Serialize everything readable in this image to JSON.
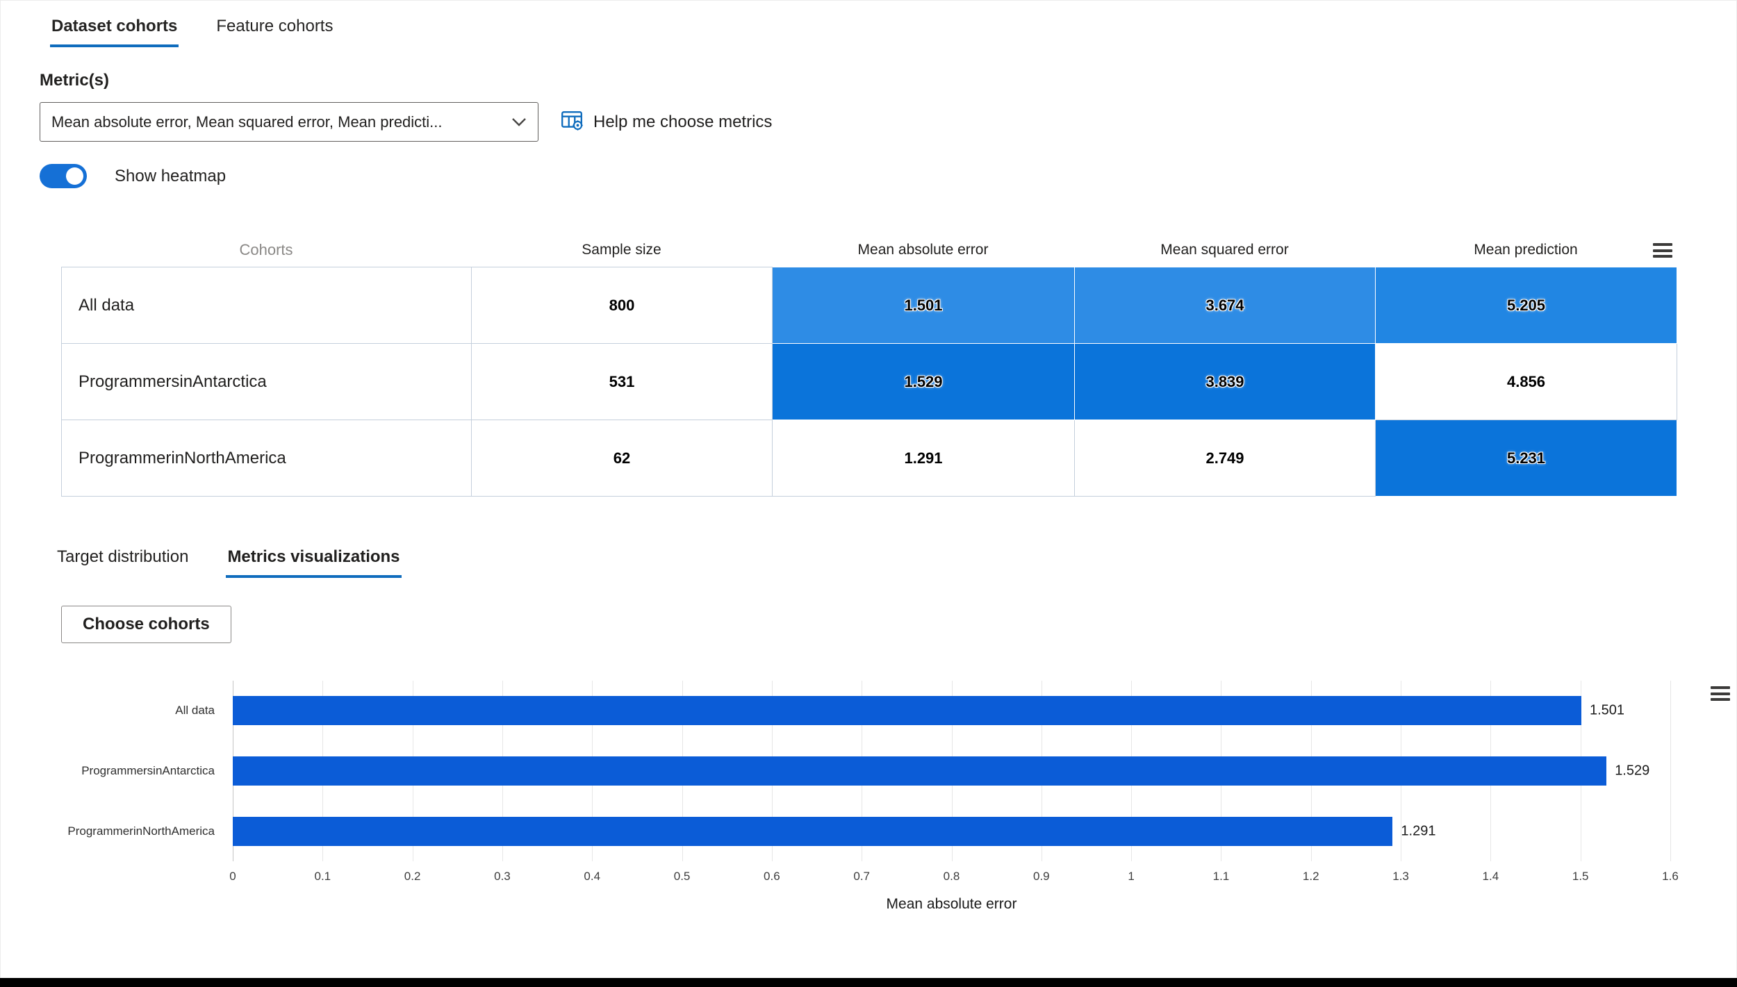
{
  "page": {
    "tabs": [
      {
        "label": "Dataset cohorts",
        "active": true
      },
      {
        "label": "Feature cohorts",
        "active": false
      }
    ]
  },
  "metrics": {
    "label": "Metric(s)",
    "dropdown_value": "Mean absolute error, Mean squared error, Mean predicti...",
    "help_label": "Help me choose metrics"
  },
  "heatmap_toggle": {
    "label": "Show heatmap",
    "state": "on"
  },
  "cohort_table": {
    "header": {
      "cohorts": "Cohorts",
      "columns": [
        "Sample size",
        "Mean absolute error",
        "Mean squared error",
        "Mean prediction"
      ]
    },
    "rows": [
      {
        "name": "All data",
        "sample_size": "800",
        "cells": [
          {
            "value": "1.501",
            "bg": "#2e8ce5",
            "heat": true
          },
          {
            "value": "3.674",
            "bg": "#2e8ce5",
            "heat": true
          },
          {
            "value": "5.205",
            "bg": "#2186e3",
            "heat": true
          }
        ]
      },
      {
        "name": "ProgrammersinAntarctica",
        "sample_size": "531",
        "cells": [
          {
            "value": "1.529",
            "bg": "#0b74da",
            "heat": true
          },
          {
            "value": "3.839",
            "bg": "#0b74da",
            "heat": true
          },
          {
            "value": "4.856",
            "bg": "#ffffff",
            "heat": false
          }
        ]
      },
      {
        "name": "ProgrammerinNorthAmerica",
        "sample_size": "62",
        "cells": [
          {
            "value": "1.291",
            "bg": "#ffffff",
            "heat": false
          },
          {
            "value": "2.749",
            "bg": "#ffffff",
            "heat": false
          },
          {
            "value": "5.231",
            "bg": "#0b74da",
            "heat": true
          }
        ]
      }
    ]
  },
  "sub_tabs": [
    {
      "label": "Target distribution",
      "active": false
    },
    {
      "label": "Metrics visualizations",
      "active": true
    }
  ],
  "choose_cohorts_label": "Choose cohorts",
  "chart_data": {
    "type": "bar",
    "orientation": "horizontal",
    "categories": [
      "All data",
      "ProgrammersinAntarctica",
      "ProgrammerinNorthAmerica"
    ],
    "values": [
      1.501,
      1.529,
      1.291
    ],
    "value_labels": [
      "1.501",
      "1.529",
      "1.291"
    ],
    "xlabel": "Mean absolute error",
    "xlim": [
      0,
      1.6
    ],
    "xticks": [
      0,
      0.1,
      0.2,
      0.3,
      0.4,
      0.5,
      0.6,
      0.7,
      0.8,
      0.9,
      1,
      1.1,
      1.2,
      1.3,
      1.4,
      1.5,
      1.6
    ],
    "xtick_labels": [
      "0",
      "0.1",
      "0.2",
      "0.3",
      "0.4",
      "0.5",
      "0.6",
      "0.7",
      "0.8",
      "0.9",
      "1",
      "1.1",
      "1.2",
      "1.3",
      "1.4",
      "1.5",
      "1.6"
    ],
    "bar_color": "#0b5cd7",
    "grid": true,
    "legend": "none"
  },
  "colors": {
    "accent": "#0f6cbd",
    "toggle_on": "#1570d6",
    "footer_bar": "#000000"
  }
}
